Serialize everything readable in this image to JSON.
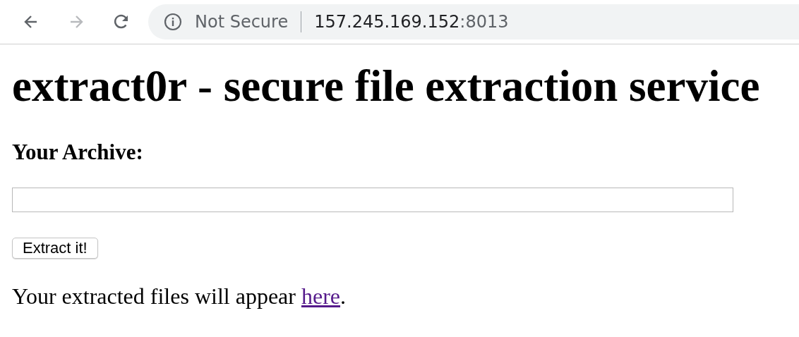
{
  "browser": {
    "nav": [
      {
        "kind": "back",
        "disabled": false
      },
      {
        "kind": "forward",
        "disabled": true
      },
      {
        "kind": "reload",
        "disabled": false
      }
    ],
    "address": {
      "security_label": "Not Secure",
      "host": "157.245.169.152",
      "port": ":8013"
    }
  },
  "page": {
    "title": "extract0r - secure file extraction service",
    "field_label": "Your Archive:",
    "button": "Extract it!",
    "note": {
      "before": "Your extracted files will appear ",
      "link": "here",
      "after": "."
    }
  }
}
